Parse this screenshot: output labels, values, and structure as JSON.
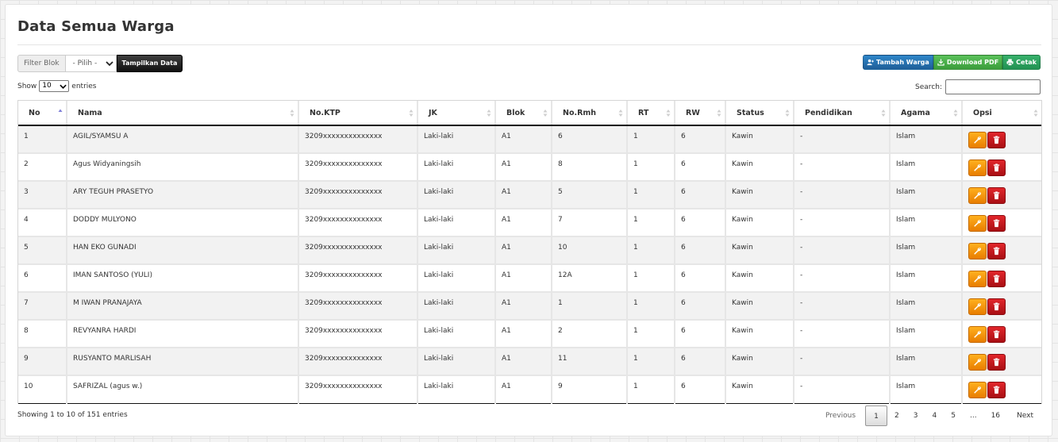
{
  "page": {
    "title": "Data Semua Warga"
  },
  "filter": {
    "label": "Filter Blok",
    "selected": "- Pilih -",
    "button": "Tampilkan Data"
  },
  "actions": {
    "tambah": "Tambah Warga",
    "pdf": "Download PDF",
    "cetak": "Cetak"
  },
  "length": {
    "show": "Show",
    "value": "10",
    "entries": "entries"
  },
  "search": {
    "label": "Search:",
    "value": ""
  },
  "table": {
    "columns": [
      "No",
      "Nama",
      "No.KTP",
      "JK",
      "Blok",
      "No.Rmh",
      "RT",
      "RW",
      "Status",
      "Pendidikan",
      "Agama",
      "Opsi"
    ],
    "rows": [
      [
        "1",
        "AGIL/SYAMSU A",
        "3209xxxxxxxxxxxxxx",
        "Laki-laki",
        "A1",
        "6",
        "1",
        "6",
        "Kawin",
        "-",
        "Islam"
      ],
      [
        "2",
        "Agus Widyaningsih",
        "3209xxxxxxxxxxxxxx",
        "Laki-laki",
        "A1",
        "8",
        "1",
        "6",
        "Kawin",
        "-",
        "Islam"
      ],
      [
        "3",
        "ARY TEGUH PRASETYO",
        "3209xxxxxxxxxxxxxx",
        "Laki-laki",
        "A1",
        "5",
        "1",
        "6",
        "Kawin",
        "-",
        "Islam"
      ],
      [
        "4",
        "DODDY MULYONO",
        "3209xxxxxxxxxxxxxx",
        "Laki-laki",
        "A1",
        "7",
        "1",
        "6",
        "Kawin",
        "-",
        "Islam"
      ],
      [
        "5",
        "HAN EKO GUNADI",
        "3209xxxxxxxxxxxxxx",
        "Laki-laki",
        "A1",
        "10",
        "1",
        "6",
        "Kawin",
        "-",
        "Islam"
      ],
      [
        "6",
        "IMAN SANTOSO (YULI)",
        "3209xxxxxxxxxxxxxx",
        "Laki-laki",
        "A1",
        "12A",
        "1",
        "6",
        "Kawin",
        "-",
        "Islam"
      ],
      [
        "7",
        "M IWAN PRANAJAYA",
        "3209xxxxxxxxxxxxxx",
        "Laki-laki",
        "A1",
        "1",
        "1",
        "6",
        "Kawin",
        "-",
        "Islam"
      ],
      [
        "8",
        "REVYANRA HARDI",
        "3209xxxxxxxxxxxxxx",
        "Laki-laki",
        "A1",
        "2",
        "1",
        "6",
        "Kawin",
        "-",
        "Islam"
      ],
      [
        "9",
        "RUSYANTO MARLISAH",
        "3209xxxxxxxxxxxxxx",
        "Laki-laki",
        "A1",
        "11",
        "1",
        "6",
        "Kawin",
        "-",
        "Islam"
      ],
      [
        "10",
        "SAFRIZAL (agus w.)",
        "3209xxxxxxxxxxxxxx",
        "Laki-laki",
        "A1",
        "9",
        "1",
        "6",
        "Kawin",
        "-",
        "Islam"
      ]
    ]
  },
  "footer": {
    "info": "Showing 1 to 10 of 151 entries",
    "previous": "Previous",
    "pages": [
      "1",
      "2",
      "3",
      "4",
      "5",
      "...",
      "16"
    ],
    "current": "1",
    "next": "Next"
  },
  "colors": {
    "tambah": "#1f5f99",
    "pdf": "#3b9d3b",
    "cetak": "#229152",
    "edit": "#e87d00",
    "delete": "#a90f14"
  },
  "icons": {
    "edit": "wrench-icon",
    "delete": "trash-icon",
    "tambah": "user-plus-icon",
    "pdf": "download-icon",
    "cetak": "print-icon",
    "sort": "sort-arrows-icon"
  }
}
